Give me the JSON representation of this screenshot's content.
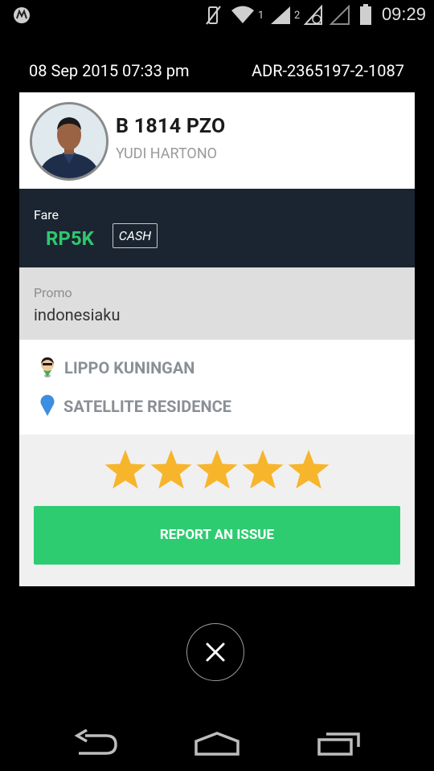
{
  "status_bar": {
    "time": "09:29",
    "sim1_label": "1",
    "sim2_label": "2",
    "icons": [
      "motorola-logo-icon",
      "vibrate-mute-icon",
      "wifi-icon",
      "signal-1-icon",
      "signal-2-icon",
      "no-signal-icon",
      "battery-icon"
    ]
  },
  "trip": {
    "date": "08 Sep 2015 07:33 pm",
    "booking_id": "ADR-2365197-2-1087"
  },
  "driver": {
    "plate": "B 1814 PZO",
    "name": "YUDI HARTONO"
  },
  "fare": {
    "label": "Fare",
    "amount": "RP5K",
    "method": "CASH"
  },
  "promo": {
    "label": "Promo",
    "code": "indonesiaku"
  },
  "route": {
    "pickup": "LIPPO KUNINGAN",
    "destination": "SATELLITE RESIDENCE"
  },
  "rating": {
    "value": 5,
    "max": 5
  },
  "actions": {
    "report": "REPORT AN ISSUE"
  },
  "colors": {
    "background": "#000000",
    "fare_bg": "#1b2531",
    "accent_green": "#2ecc71",
    "star": "#f7b52c",
    "promo_bg": "#dedede",
    "rating_bg": "#f0f0f0"
  }
}
